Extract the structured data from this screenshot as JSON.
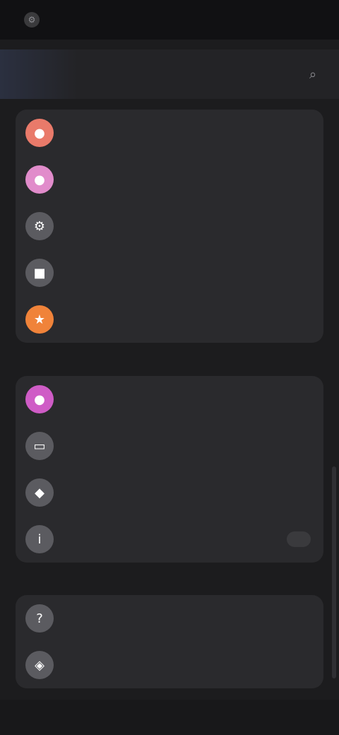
{
  "status_bar": {
    "icon": "gear-icon",
    "text": ""
  },
  "header": {
    "title": "",
    "right_icon": "search-icon"
  },
  "groups": [
    {
      "items": [
        {
          "label": "",
          "icon": "person-icon",
          "color": "#e97a6a"
        },
        {
          "label": "",
          "icon": "bell-icon",
          "color": "#e18ccb"
        },
        {
          "label": "",
          "icon": "gear-icon",
          "color": "#5b5b60"
        },
        {
          "label": "",
          "icon": "lock-icon",
          "color": "#5b5b60"
        },
        {
          "label": "",
          "icon": "star-icon",
          "color": "#f0833a"
        }
      ]
    },
    {
      "items": [
        {
          "label": "",
          "icon": "palette-icon",
          "color": "#cf5cc6"
        },
        {
          "label": "",
          "icon": "folder-icon",
          "color": "#5b5b60"
        },
        {
          "label": "",
          "icon": "chat-icon",
          "color": "#5b5b60"
        },
        {
          "label": "",
          "icon": "info-icon",
          "color": "#5b5b60",
          "badge": true
        }
      ]
    },
    {
      "items": [
        {
          "label": "",
          "icon": "help-icon",
          "color": "#5b5b60"
        },
        {
          "label": "",
          "icon": "shield-icon",
          "color": "#5b5b60"
        }
      ]
    }
  ]
}
